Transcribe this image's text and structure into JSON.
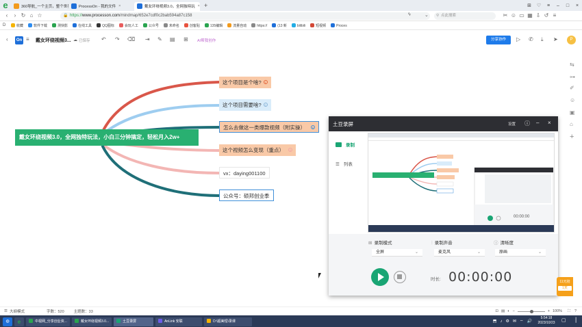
{
  "browser": {
    "tabs": [
      {
        "label": "360导航_一个主页，整个世界",
        "icon_color": "#f29a1c",
        "active": false
      },
      {
        "label": "ProcessOn - 我的文件",
        "icon_color": "#1e6fd9",
        "active": false
      },
      {
        "label": "戴女环绕视频3.0，全网独特玩",
        "icon_color": "#1e6fd9",
        "active": true
      }
    ],
    "new_tab": "+",
    "url_host": "www.processon.com",
    "url_path": "/mindmap/652e7cdf0c2bab594a87c158",
    "url_scheme": "https://",
    "search_placeholder": "点此搜索",
    "bookmarks": [
      {
        "label": "收藏",
        "color": "#f5b400"
      },
      {
        "label": "软件下载",
        "color": "#2d8cf0"
      },
      {
        "label": "测快影",
        "color": "#2aa44f"
      },
      {
        "label": "在线工具",
        "color": "#1e6fd9"
      },
      {
        "label": "QQ图标",
        "color": "#333333"
      },
      {
        "label": "会玩人工",
        "color": "#e85d5d"
      },
      {
        "label": "公众号",
        "color": "#2aa44f"
      },
      {
        "label": "未命名",
        "color": "#888888"
      },
      {
        "label": "创客贴",
        "color": "#e8533f"
      },
      {
        "label": "135编辑",
        "color": "#2aa44f"
      },
      {
        "label": "流量自动",
        "color": "#f29a1c"
      },
      {
        "label": "https://",
        "color": "#888888"
      },
      {
        "label": "(13 新",
        "color": "#1e6fd9"
      },
      {
        "label": "bilibili",
        "color": "#23ade5"
      },
      {
        "label": "短视频",
        "color": "#d34836"
      },
      {
        "label": "Proces",
        "color": "#1e6fd9"
      }
    ]
  },
  "app": {
    "logo": "On",
    "doc_title": "戴女环绕视频3...",
    "saved_status": "已保存",
    "ai_label": "AI帮我创作",
    "share_label": "分享协作",
    "avatar_letter": "P"
  },
  "mindmap": {
    "root": "戴女环绕视频3.0，全网独特玩法，小白三分钟搞定，轻松月入2w+",
    "branches": [
      {
        "label": "这个项目是个啥?",
        "badge": "1",
        "line_color": "#d9574a",
        "fill": "#f9c9a7",
        "border": ""
      },
      {
        "label": "这个项目需要啥?",
        "badge": "2",
        "line_color": "#9ecdf0",
        "fill": "#d9ecfa",
        "border": ""
      },
      {
        "label": "怎么去做这一类爆款视频（附实操）",
        "badge": "6",
        "line_color": "#1f6f78",
        "fill": "#f9c9a7",
        "border": "#3f8fd8"
      },
      {
        "label": "这个视频怎么变现（重点）",
        "badge": "3",
        "line_color": "#f3b6b4",
        "fill": "#f9c9a7",
        "border": ""
      },
      {
        "label": "vx：daying001100",
        "badge": "",
        "line_color": "#f3b6b4",
        "fill": "#ffffff",
        "border": "#e6e6e6"
      },
      {
        "label": "公众号：硕邦创业季",
        "badge": "",
        "line_color": "#1f6f78",
        "fill": "#ffffff",
        "border": "#3f8fd8"
      }
    ]
  },
  "status_bar": {
    "mode": "大纲模式",
    "word_count_label": "字数：520",
    "topic_count_label": "主题数：33",
    "zoom": "100%"
  },
  "recorder": {
    "title": "土豆录屏",
    "settings": "设置",
    "nav": [
      {
        "label": "录制",
        "active": true
      },
      {
        "label": "列表",
        "active": false
      }
    ],
    "options": [
      {
        "label": "录制模式",
        "value": "全屏"
      },
      {
        "label": "录制声音",
        "value": "麦克风"
      },
      {
        "label": "清晰度",
        "value": "原画"
      }
    ],
    "duration_label": "时长:",
    "timer": "00:00:00",
    "preview_timer": "00:00:00"
  },
  "float_tag": {
    "line1": "11元抢",
    "line2": "1天"
  },
  "taskbar": {
    "apps": [
      {
        "label": "中视网_分享创业资...",
        "color": "#2aa44f"
      },
      {
        "label": "戴女环绕视频3.0...",
        "color": "#2aa44f"
      },
      {
        "label": "土豆录屏",
        "color": "#1aa574",
        "active": true
      },
      {
        "label": "AnLink 安联",
        "color": "#6c5ce7"
      },
      {
        "label": "D:\\超美短\\录课",
        "color": "#f5b400"
      }
    ],
    "time": "5:54:18",
    "date": "2023/10/23"
  }
}
